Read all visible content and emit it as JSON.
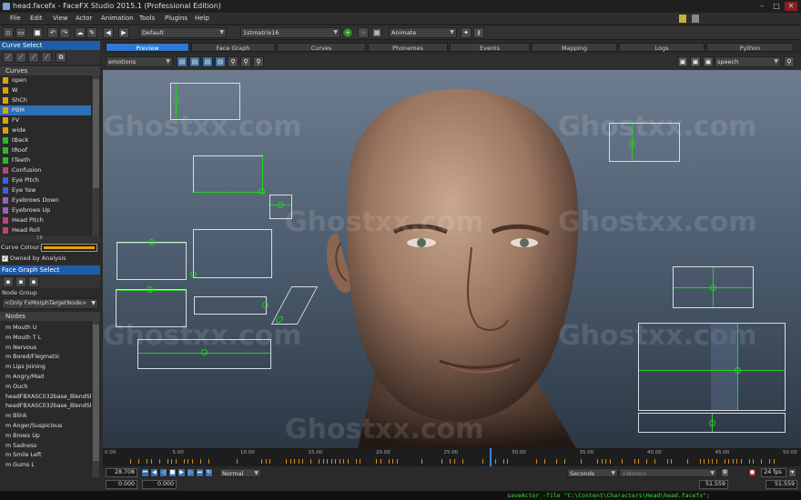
{
  "window": {
    "title": "head.facefx - FaceFX Studio 2015.1 (Professional Edition)",
    "buttons": [
      "–",
      "□",
      "✕"
    ]
  },
  "menu": [
    "File",
    "Edit",
    "View",
    "Actor",
    "Animation",
    "Tools",
    "Plugins",
    "Help"
  ],
  "toolbar": {
    "group": "Default",
    "anim": "1stmatrix16",
    "mode": "Animate"
  },
  "curve_select": {
    "title": "Curve Select",
    "curves_header": "Curves",
    "curves": [
      {
        "label": "open",
        "color": "#e0a000"
      },
      {
        "label": "W",
        "color": "#e0a000"
      },
      {
        "label": "ShCh",
        "color": "#e0a000"
      },
      {
        "label": "PBM",
        "color": "#e0a000",
        "selected": true
      },
      {
        "label": "FV",
        "color": "#e0a000"
      },
      {
        "label": "wide",
        "color": "#e0a000"
      },
      {
        "label": "tBack",
        "color": "#22c022"
      },
      {
        "label": "tRoof",
        "color": "#22c022"
      },
      {
        "label": "tTeeth",
        "color": "#22c022"
      },
      {
        "label": "Confusion",
        "color": "#c04080"
      },
      {
        "label": "Eye Pitch",
        "color": "#4060e0"
      },
      {
        "label": "Eye Yaw",
        "color": "#4060e0"
      },
      {
        "label": "Eyebrows Down",
        "color": "#a060c0"
      },
      {
        "label": "Eyebrows Up",
        "color": "#a060c0"
      },
      {
        "label": "Head Pitch",
        "color": "#c04080"
      },
      {
        "label": "Head Roll",
        "color": "#c04080"
      }
    ],
    "scroll_value": "16",
    "curve_colour_label": "Curve Colour:",
    "curve_colour": "#e8a000",
    "owned_label": "Owned by Analysis"
  },
  "face_graph_select": {
    "title": "Face Graph Select",
    "node_group_label": "Node Group",
    "node_group": "<Only FxMorphTargetNode>",
    "nodes_header": "Nodes",
    "nodes": [
      "m Mouth U",
      "m Mouth T L",
      "m Nervous",
      "m Bored/Flegmatic",
      "m Lips Joining",
      "m Angry/Mad",
      "m Ouch",
      "headFBXASC032base_BlendSh",
      "headFBXASC032base_BlendSh",
      "m Blink",
      "m Anger/Suspicious",
      "m Brows Up",
      "m Sadness",
      "m Smile Left",
      "m Gums L"
    ]
  },
  "tabs": [
    "Preview",
    "Face Graph",
    "Curves",
    "Phonemes",
    "Events",
    "Mapping",
    "Logs",
    "Python"
  ],
  "viewer": {
    "left_combo": "emotions",
    "right_combo": "speech",
    "watermark": "Ghostxx.com"
  },
  "timeline": {
    "ticks": [
      "0.00",
      "5.00",
      "10.00",
      "15.00",
      "20.00",
      "25.00",
      "30.00",
      "35.00",
      "40.00",
      "45.00",
      "50.00"
    ]
  },
  "playback": {
    "time": "28.708",
    "mode": "Normal",
    "units": "Seconds",
    "none_combo": "<None>",
    "fps": "24 fps",
    "start": "0.000",
    "start2": "0.000",
    "end": "51.559",
    "end2": "51.559"
  },
  "status": {
    "text": "saveActor -file \"C:\\Content\\Characters\\Head\\head.facefx\";"
  },
  "colors": {
    "accent": "#2f79d0",
    "slider_green": "#22d022",
    "status_text": "#e6c800"
  }
}
